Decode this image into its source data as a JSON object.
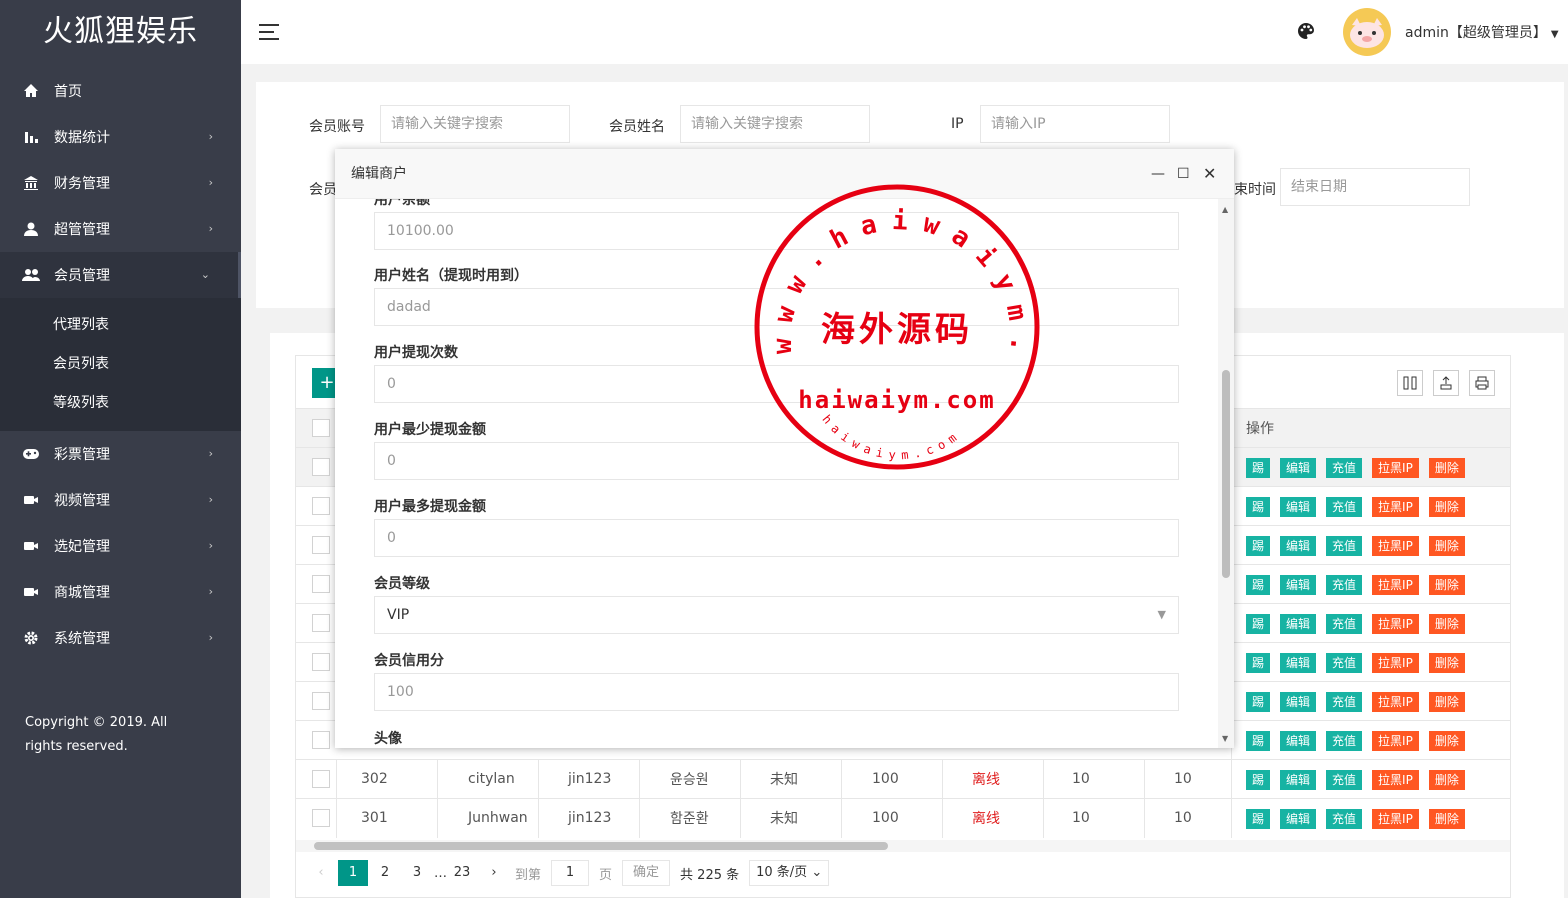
{
  "app": {
    "logo": "火狐狸娱乐",
    "copyright": "Copyright © 2019. All rights reserved.",
    "user": "admin【超级管理员】"
  },
  "sidebar": {
    "items": [
      {
        "label": "首页",
        "icon": "home-icon",
        "arrow": ""
      },
      {
        "label": "数据统计",
        "icon": "bar-chart-icon",
        "arrow": "›"
      },
      {
        "label": "财务管理",
        "icon": "bank-icon",
        "arrow": "›"
      },
      {
        "label": "超管管理",
        "icon": "user-icon",
        "arrow": "›"
      },
      {
        "label": "会员管理",
        "icon": "users-icon",
        "arrow": "⌄"
      },
      {
        "label": "彩票管理",
        "icon": "gamepad-icon",
        "arrow": "›"
      },
      {
        "label": "视频管理",
        "icon": "video-icon",
        "arrow": "›"
      },
      {
        "label": "选妃管理",
        "icon": "video-icon",
        "arrow": "›"
      },
      {
        "label": "商城管理",
        "icon": "video-icon",
        "arrow": "›"
      },
      {
        "label": "系统管理",
        "icon": "gear-icon",
        "arrow": "›"
      }
    ],
    "sub": [
      "代理列表",
      "会员列表",
      "等级列表"
    ]
  },
  "filters": {
    "account_label": "会员账号",
    "account_placeholder": "请输入关键字搜索",
    "name_label": "会员姓名",
    "name_placeholder": "请输入关键字搜索",
    "ip_label": "IP",
    "ip_placeholder": "请输入IP",
    "row2_label_left": "会员",
    "row2_label_right": "束时间",
    "end_placeholder": "结束日期"
  },
  "table": {
    "add_label": "+",
    "ops_header": "操作",
    "op_labels": [
      "踢",
      "编辑",
      "充值",
      "拉黑IP",
      "删除"
    ],
    "rows": [
      {
        "id": "302",
        "account": "citylan",
        "agent": "jin123",
        "name": "윤승원",
        "gender": "未知",
        "credit": "100",
        "status": "离线",
        "a": "10",
        "b": "10"
      },
      {
        "id": "301",
        "account": "Junhwan",
        "agent": "jin123",
        "name": "함준환",
        "gender": "未知",
        "credit": "100",
        "status": "离线",
        "a": "10",
        "b": "10"
      }
    ],
    "hidden_row_count": 8
  },
  "pager": {
    "prev": "‹",
    "pages": [
      "1",
      "2",
      "3"
    ],
    "ellipsis": "…",
    "last": "23",
    "next": "›",
    "goto": "到第",
    "goto_value": "1",
    "page_unit": "页",
    "confirm": "确定",
    "total": "共 225 条",
    "per_page": "10 条/页"
  },
  "modal": {
    "title": "编辑商户",
    "cut_label": "用户余额",
    "balance": "10100.00",
    "fields": [
      {
        "label": "用户姓名（提现时用到）",
        "value": "dadad"
      },
      {
        "label": "用户提现次数",
        "value": "0"
      },
      {
        "label": "用户最少提现金额",
        "value": "0"
      },
      {
        "label": "用户最多提现金额",
        "value": "0"
      },
      {
        "label": "会员等级",
        "value": "VIP"
      },
      {
        "label": "会员信用分",
        "value": "100"
      }
    ],
    "avatar_label": "头像"
  },
  "stamp": {
    "top": "www.haiwaiym.com",
    "center": "海外源码",
    "domain": "haiwaiym.com",
    "bottom": "haiwaiym.com"
  },
  "colors": {
    "sidebar": "#393d49",
    "primary": "#009688",
    "danger": "#ff5722",
    "op_green": "#17b3a3",
    "stamp_red": "#e60012",
    "status_red": "#e02020"
  }
}
